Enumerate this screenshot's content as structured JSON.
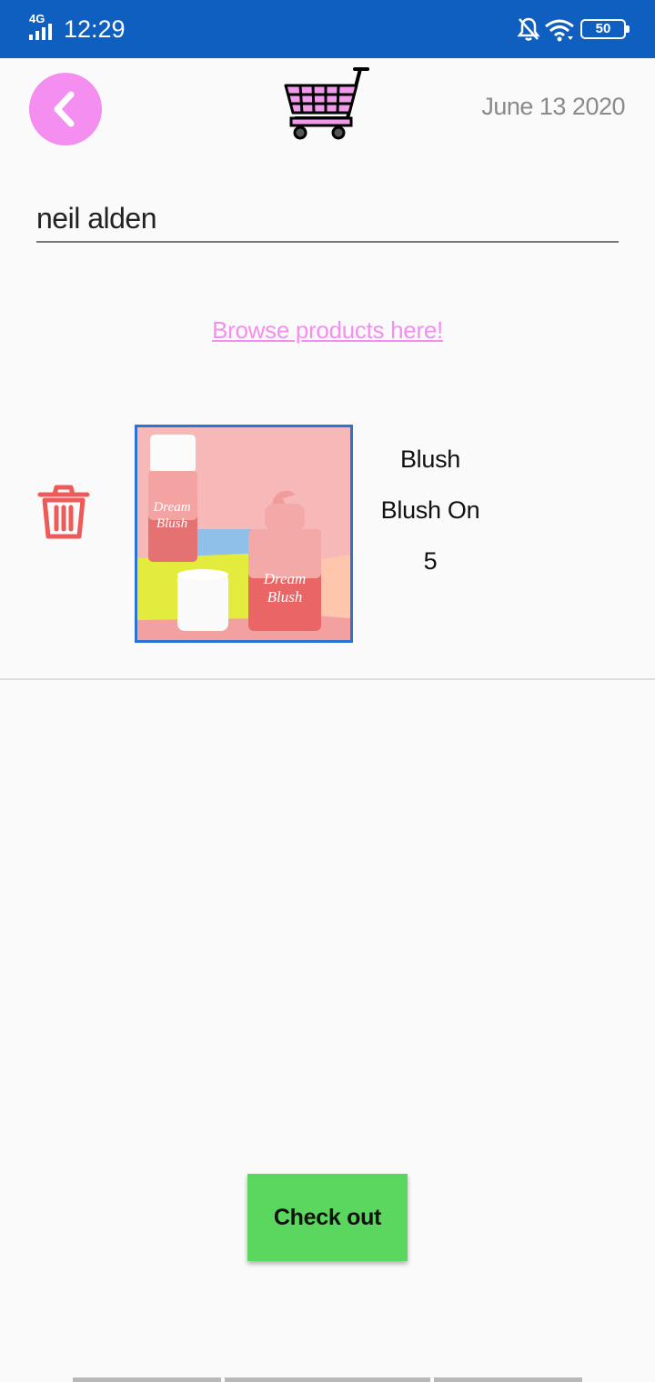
{
  "status_bar": {
    "network": "4G",
    "time": "12:29",
    "battery": "50",
    "icons": [
      "signal-icon",
      "mute-icon",
      "wifi-icon",
      "battery-icon"
    ]
  },
  "header": {
    "back_icon": "chevron-left-icon",
    "cart_icon": "shopping-cart-icon",
    "date": "June 13 2020"
  },
  "customer": {
    "name": "neil alden"
  },
  "browse_link": "Browse products here!",
  "cart_items": [
    {
      "category": "Blush",
      "name": "Blush On",
      "quantity": "5",
      "delete_icon": "trash-icon",
      "image_desc": "dream-blush-product-image"
    }
  ],
  "checkout_label": "Check out",
  "colors": {
    "status_bar": "#0f5fc1",
    "accent_pink": "#f48ef0",
    "checkout_green": "#5bd65e",
    "delete_red": "#ec5a5a",
    "image_border": "#2a72d4"
  }
}
